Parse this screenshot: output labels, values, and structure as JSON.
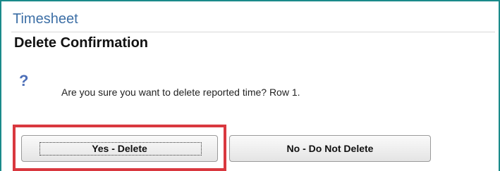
{
  "app": {
    "title": "Timesheet"
  },
  "dialog": {
    "heading": "Delete Confirmation",
    "icon": "question-icon",
    "icon_glyph": "?",
    "message": "Are you sure you want to delete reported time? Row 1."
  },
  "buttons": {
    "yes_label": "Yes - Delete",
    "no_label": "No - Do Not Delete"
  },
  "colors": {
    "frame_border": "#1a8a8a",
    "title": "#3d6fa6",
    "icon": "#4d6fb8",
    "highlight": "#d9383f"
  }
}
